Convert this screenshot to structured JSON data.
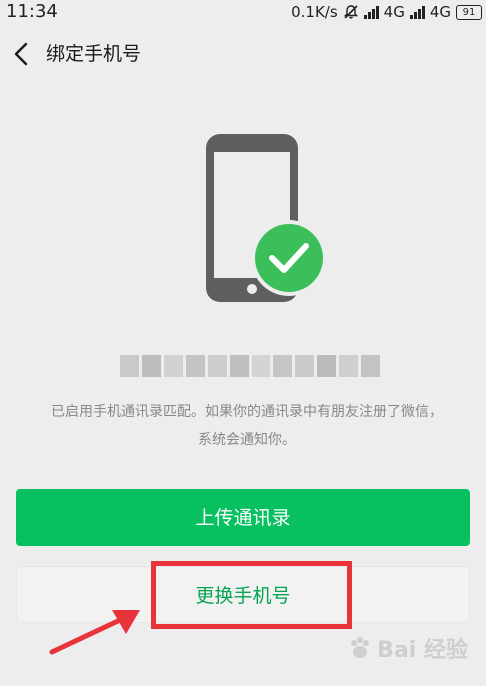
{
  "status_bar": {
    "time": "11:34",
    "speed": "0.1K/s",
    "network_1": "4G",
    "network_2": "4G",
    "battery": "91"
  },
  "header": {
    "title": "绑定手机号"
  },
  "main": {
    "description_line1": "已启用手机通讯录匹配。如果你的通讯录中有朋友注册了微信，",
    "description_line2": "系统会通知你。",
    "upload_button_label": "上传通讯录",
    "change_button_label": "更换手机号"
  },
  "watermark": {
    "text": "Bai 经验"
  },
  "colors": {
    "primary_green": "#07c160",
    "background": "#ededed",
    "highlight_red": "#e8333a"
  },
  "icons": {
    "back": "chevron-left-icon",
    "phone": "phone-icon",
    "check": "check-circle-icon",
    "mute": "bell-muted-icon"
  }
}
